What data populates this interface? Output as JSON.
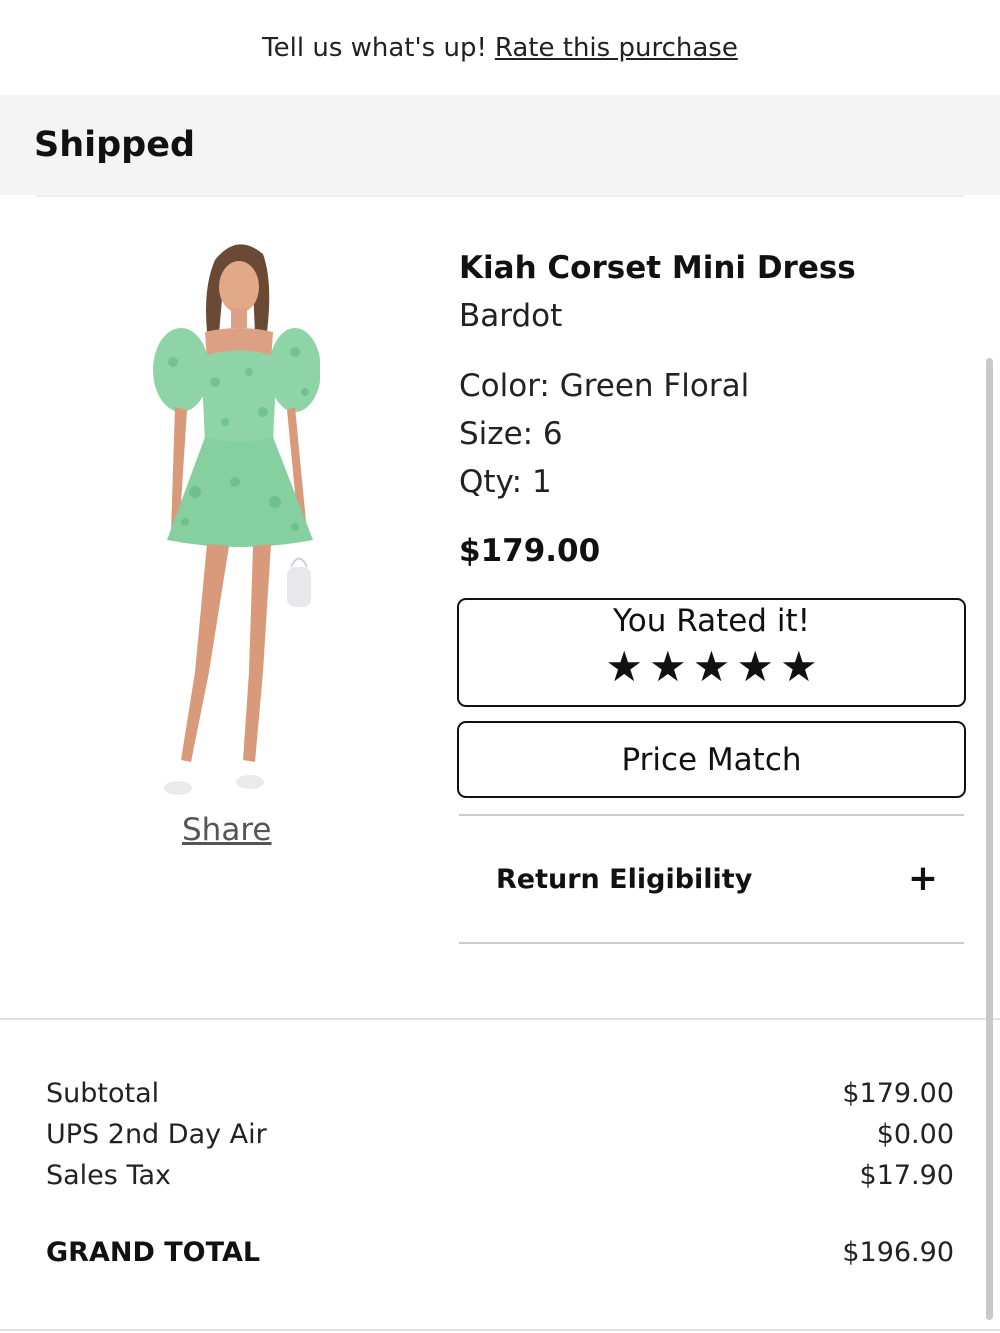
{
  "banner": {
    "text": "Tell us what's up!",
    "link": "Rate this purchase"
  },
  "order": {
    "status": "Shipped"
  },
  "product": {
    "image_alt": "Kiah Corset Mini Dress - Green Floral",
    "name": "Kiah Corset Mini Dress",
    "brand": "Bardot",
    "color_text": "Color: Green Floral",
    "size_text": "Size: 6",
    "qty_text": "Qty: 1",
    "price": "$179.00",
    "share_label": "Share",
    "rating": {
      "label": "You Rated it!",
      "stars": 5,
      "max_stars": 5,
      "star_glyph": "★"
    },
    "price_match_label": "Price Match",
    "return_eligibility_label": "Return Eligibility",
    "expand_glyph": "+"
  },
  "summary": {
    "subtotal_label": "Subtotal",
    "subtotal_value": "$179.00",
    "shipping_label": "UPS 2nd Day Air",
    "shipping_value": "$0.00",
    "tax_label": "Sales Tax",
    "tax_value": "$17.90",
    "grand_total_label": "GRAND TOTAL",
    "grand_total_value": "$196.90"
  },
  "colors": {
    "dress_green": "#8fd4a6",
    "status_bar_bg": "#f4f4f4",
    "text_primary": "#111111"
  }
}
